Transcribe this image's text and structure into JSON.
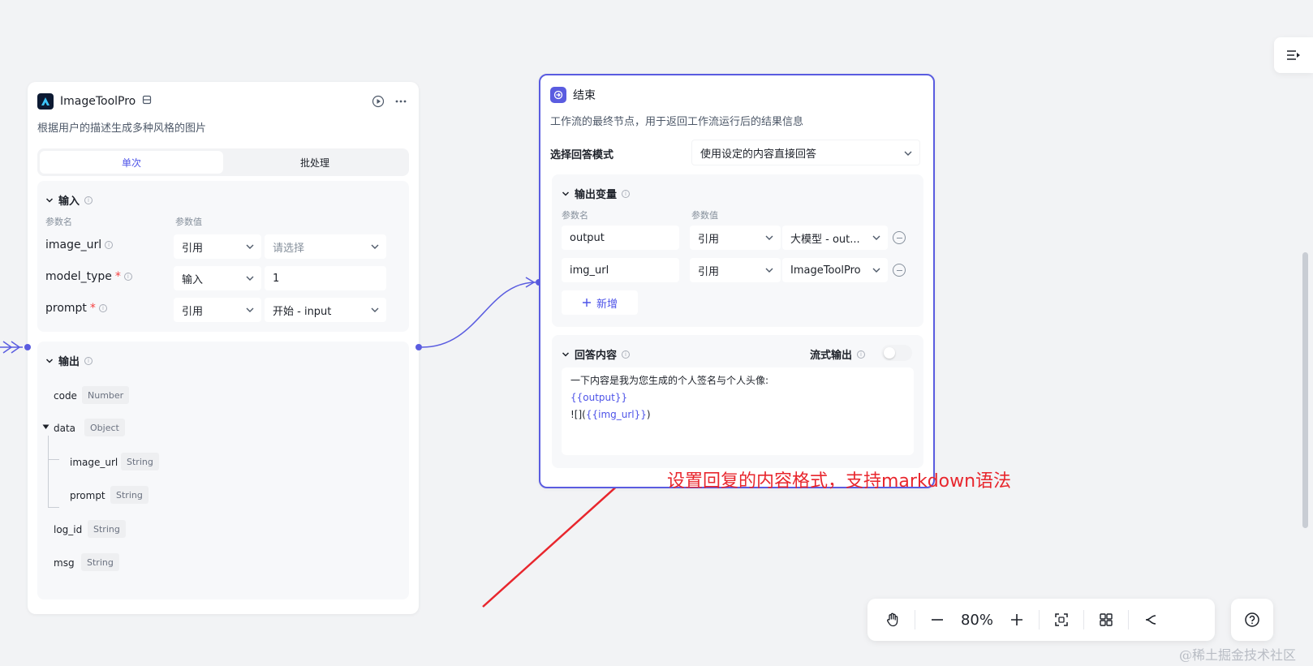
{
  "tool_node": {
    "title": "ImageToolPro",
    "description": "根据用户的描述生成多种风格的图片",
    "tabs": [
      "单次",
      "批处理"
    ],
    "active_tab": "单次",
    "input_section": {
      "title": "输入",
      "col_name": "参数名",
      "col_value": "参数值",
      "params": [
        {
          "name": "image_url",
          "required": "",
          "mode": "引用",
          "value": "请选择",
          "value_is_placeholder": true
        },
        {
          "name": "model_type",
          "required": "*",
          "mode": "输入",
          "value": "1"
        },
        {
          "name": "prompt",
          "required": "*",
          "mode": "引用",
          "value": "开始 - input"
        }
      ]
    },
    "output_section": {
      "title": "输出",
      "fields": [
        {
          "name": "code",
          "type": "Number"
        },
        {
          "name": "data",
          "type": "Object"
        },
        {
          "name": "image_url",
          "type": "String"
        },
        {
          "name": "prompt",
          "type": "String"
        },
        {
          "name": "log_id",
          "type": "String"
        },
        {
          "name": "msg",
          "type": "String"
        }
      ]
    }
  },
  "end_node": {
    "title": "结束",
    "description": "工作流的最终节点，用于返回工作流运行后的结果信息",
    "mode_label": "选择回答模式",
    "mode_value": "使用设定的内容直接回答",
    "output_vars": {
      "title": "输出变量",
      "col_name": "参数名",
      "col_value": "参数值",
      "rows": [
        {
          "name": "output",
          "mode": "引用",
          "value": "大模型 - out..."
        },
        {
          "name": "img_url",
          "mode": "引用",
          "value": "ImageToolPro"
        }
      ],
      "add_label": "新增"
    },
    "answer": {
      "title": "回答内容",
      "stream_label": "流式输出",
      "line1": "一下内容是我为您生成的个人签名与个人头像:",
      "line2": "{{output}}",
      "line3_prefix": "![](",
      "line3_var": "{{img_url}}",
      "line3_suffix": ")"
    }
  },
  "toolbar": {
    "zoom": "80%"
  },
  "annotation": "设置回复的内容格式，支持markdown语法",
  "watermark": "@稀土掘金技术社区",
  "colors": {
    "accent": "#4d53e8",
    "node_border": "#5a5ce0",
    "annotation": "#e8262d"
  }
}
